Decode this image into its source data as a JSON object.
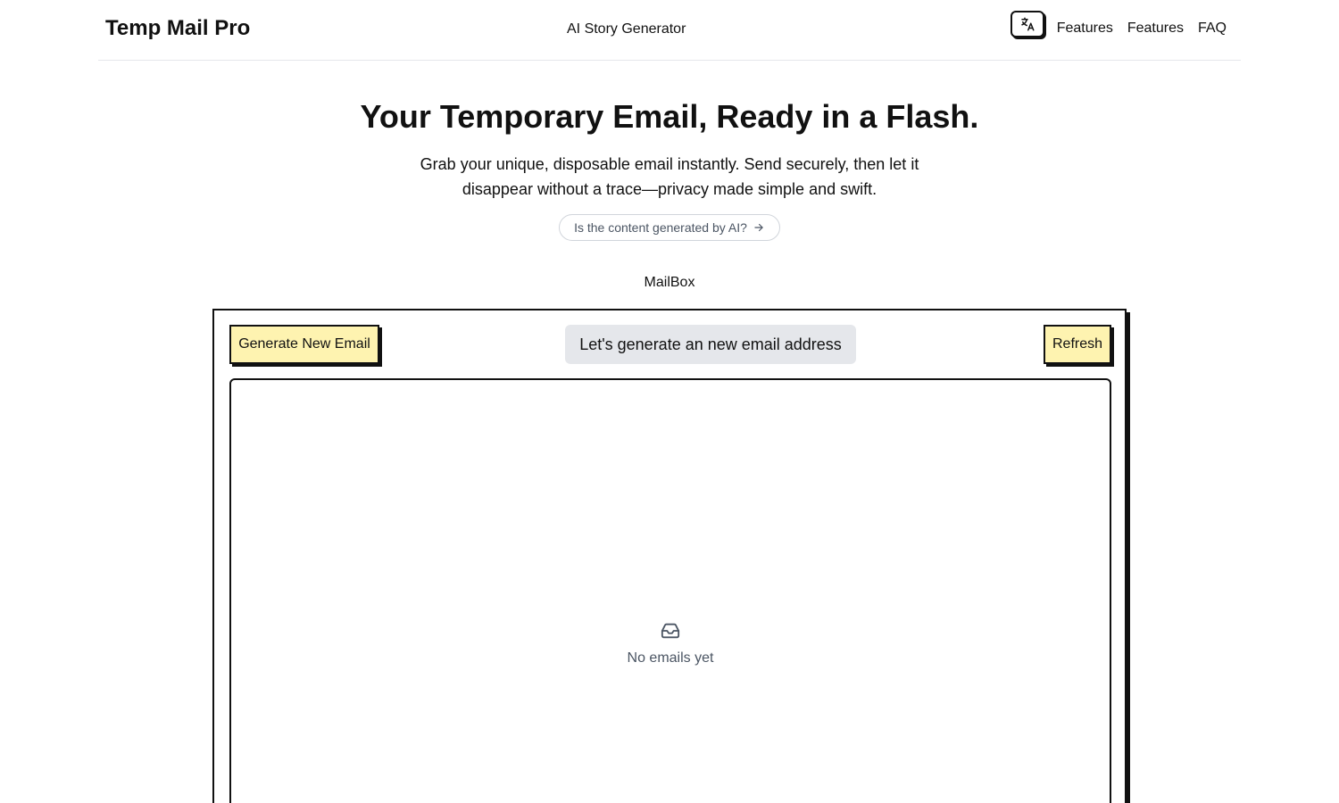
{
  "header": {
    "brand": "Temp Mail Pro",
    "center_link": "AI Story Generator",
    "language_icon": "translate-icon",
    "nav": [
      {
        "label": "Features"
      },
      {
        "label": "Features"
      },
      {
        "label": "FAQ"
      }
    ]
  },
  "hero": {
    "title": "Your Temporary Email, Ready in a Flash.",
    "subtitle": "Grab your unique, disposable email instantly. Send securely, then let it disappear without a trace—privacy made simple and swift.",
    "ai_badge": "Is the content generated by AI?",
    "ai_badge_icon": "arrow-right-icon"
  },
  "mailbox": {
    "label": "MailBox",
    "generate_button": "Generate New Email",
    "email_placeholder": "Let's generate an new email address",
    "refresh_button": "Refresh",
    "empty_icon": "inbox-icon",
    "empty_text": "No emails yet"
  },
  "colors": {
    "button_yellow": "#fef3b0",
    "email_bg": "#e5e7eb",
    "border": "#111111",
    "muted_text": "#4b5563"
  }
}
